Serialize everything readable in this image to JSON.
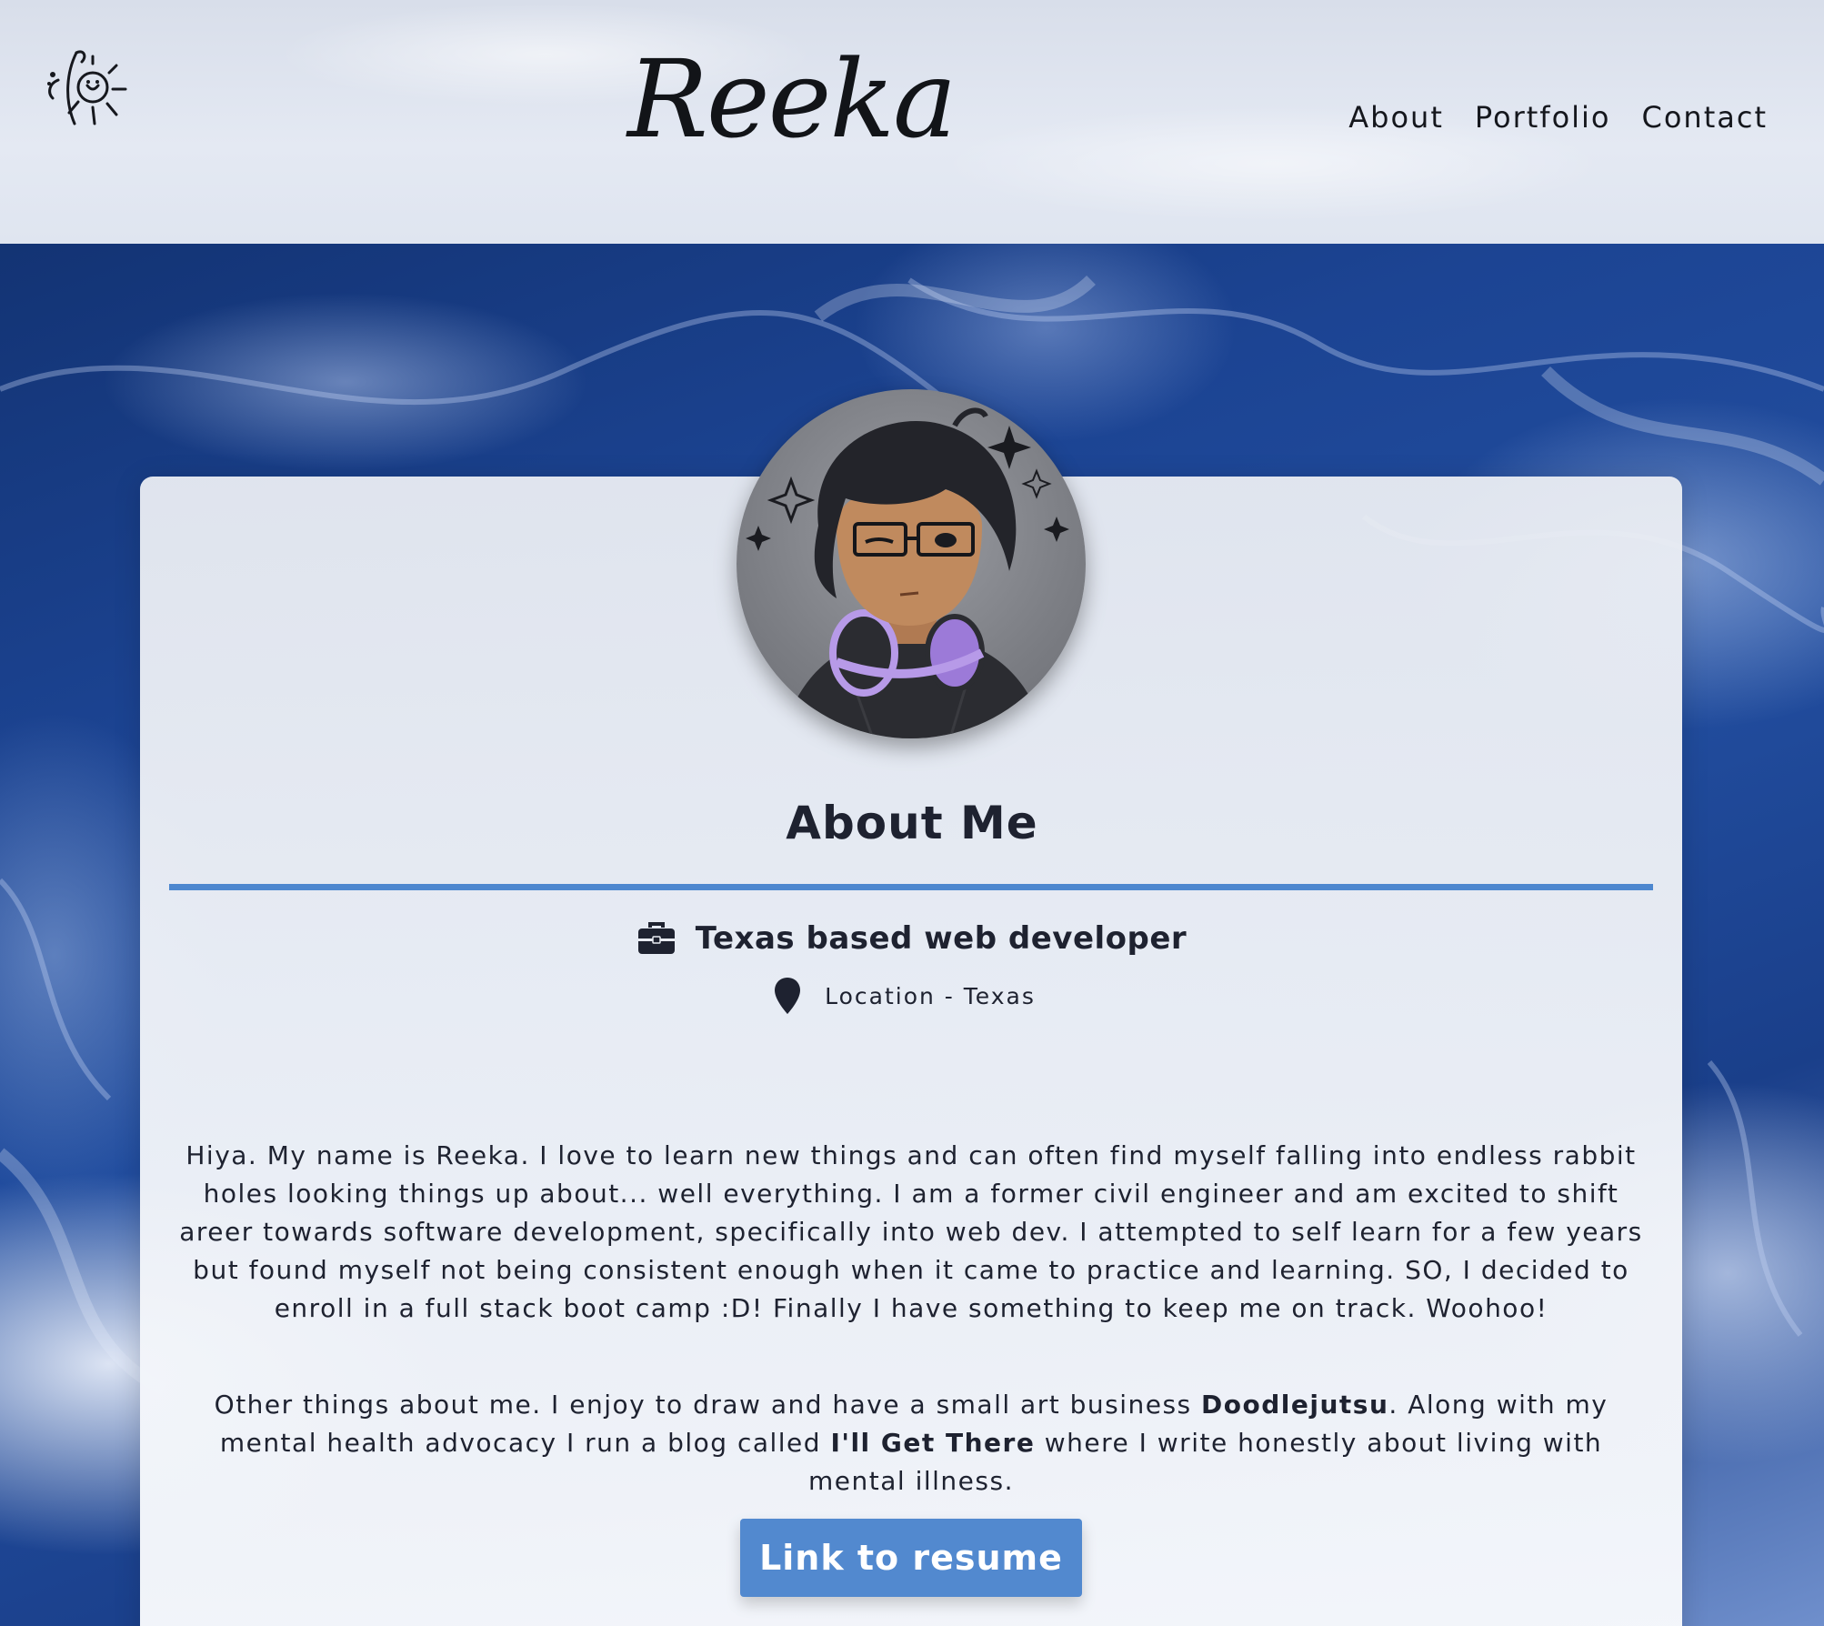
{
  "header": {
    "brand": "Reeka",
    "nav": [
      {
        "label": "About"
      },
      {
        "label": "Portfolio"
      },
      {
        "label": "Contact"
      }
    ]
  },
  "about": {
    "title": "About Me",
    "role": "Texas based web developer",
    "location": "Location - Texas",
    "paragraph1": "Hiya. My name is Reeka. I love to learn new things and can often find myself falling into endless rabbit holes looking things up about... well everything. I am a former civil engineer and am excited to shift areer towards software development, specifically into web dev. I attempted to self learn for a few years but found myself not being consistent enough when it came to practice and learning. SO, I decided to enroll in a full stack boot camp :D! Finally I have something to keep me on track. Woohoo!",
    "paragraph2": {
      "part1": "Other things about me. I enjoy to draw and have a small art business ",
      "business": "Doodlejutsu",
      "part2": ". Along with my mental health advocacy I run a blog called ",
      "blog": "I'll Get There",
      "part3": " where I write honestly about living with mental illness."
    },
    "resume_button": "Link to resume"
  },
  "icons": {
    "logo": "sun-hand-logo-icon",
    "role": "briefcase-icon",
    "location": "map-pin-icon"
  },
  "colors": {
    "accent": "#4d87cf",
    "button": "#5289cf",
    "text": "#1e2230",
    "background": "#1c4493"
  }
}
